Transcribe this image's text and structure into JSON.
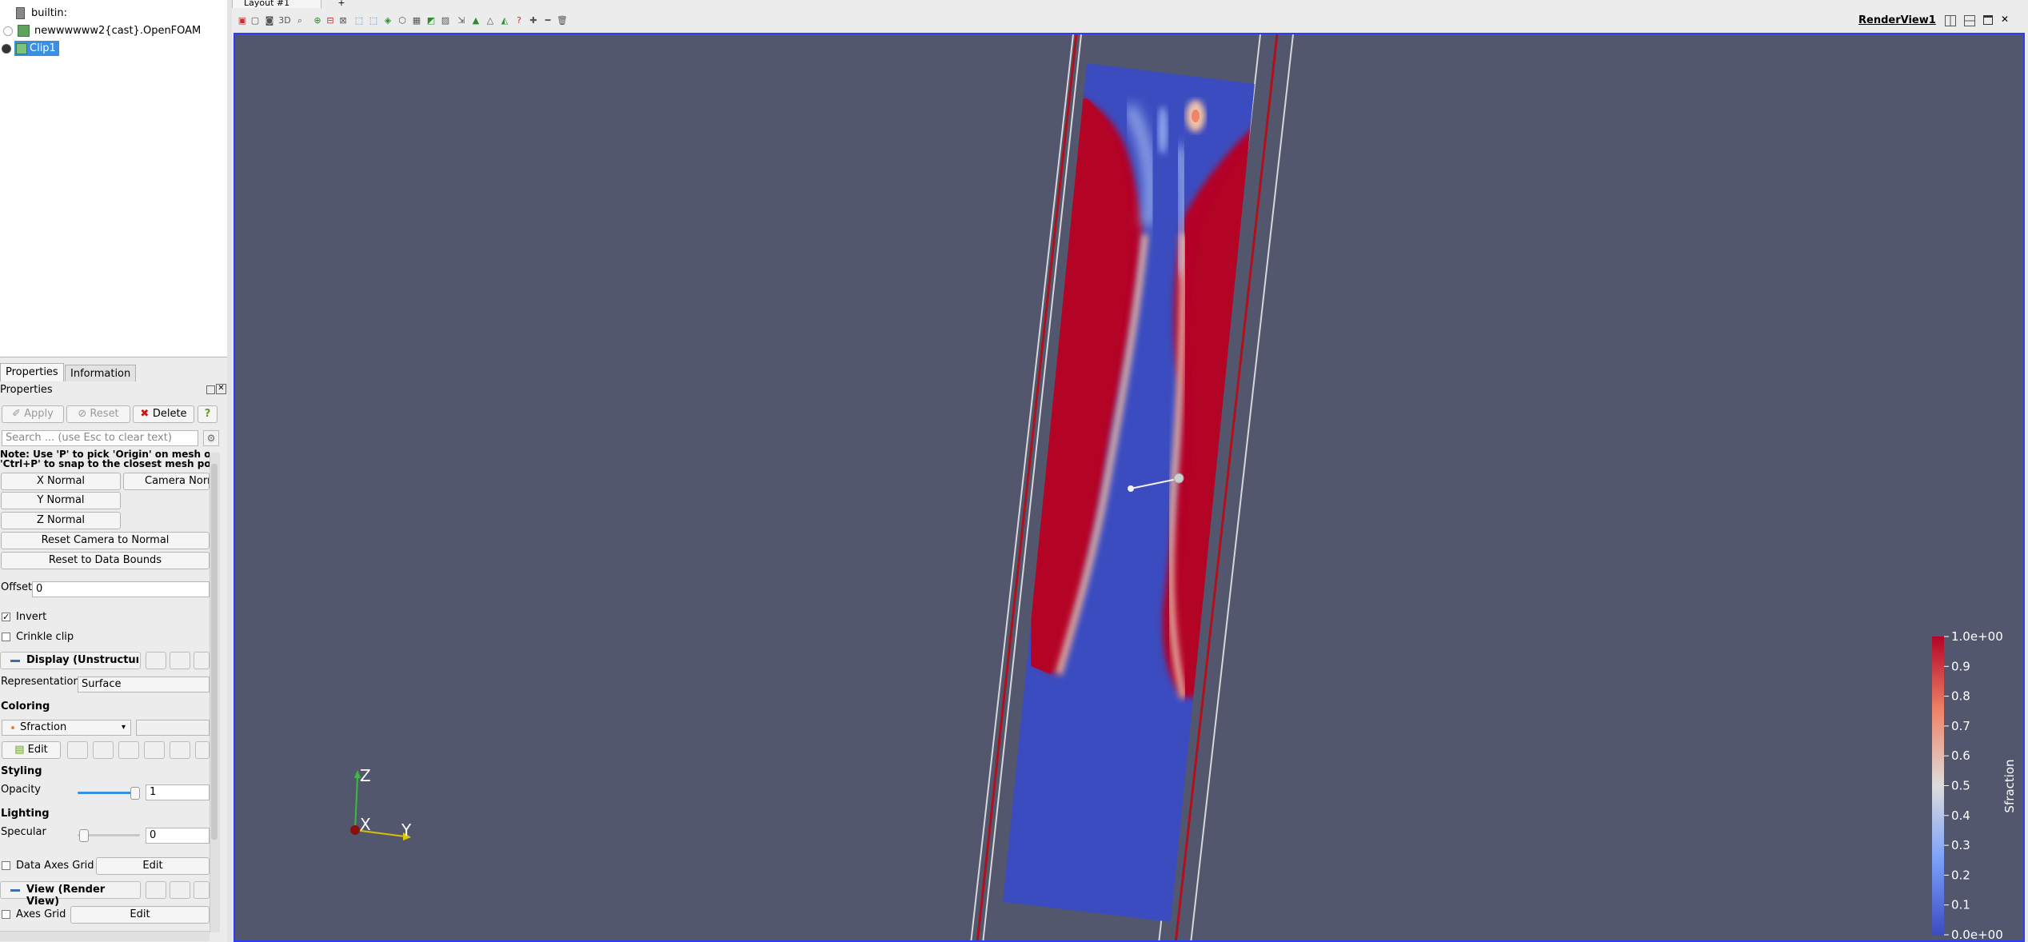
{
  "layout_tab": {
    "label": "Layout #1",
    "add_label": "+"
  },
  "pipeline": {
    "items": [
      {
        "label": "builtin:"
      },
      {
        "label": "newwwwww2{cast}.OpenFOAM"
      },
      {
        "label": "Clip1"
      }
    ]
  },
  "panel_tabs": {
    "properties": "Properties",
    "information": "Information"
  },
  "properties": {
    "header": "Properties",
    "apply_label": "Apply",
    "reset_label": "Reset",
    "delete_label": "Delete",
    "help_label": "?",
    "search_placeholder": "Search ... (use Esc to clear text)",
    "note_line1": "Note: Use 'P' to pick 'Origin' on mesh o",
    "note_line2": "'Ctrl+P' to snap to the closest mesh po",
    "x_normal": "X Normal",
    "camera_normal": "Camera Norm",
    "y_normal": "Y Normal",
    "z_normal": "Z Normal",
    "reset_camera": "Reset Camera to Normal",
    "reset_bounds": "Reset to Data Bounds",
    "offset_label": "Offset",
    "offset_value": "0",
    "invert_label": "Invert",
    "crinkle_label": "Crinkle clip",
    "display_section": "Display (Unstructur",
    "representation_label": "Representation",
    "representation_value": "Surface",
    "coloring_label": "Coloring",
    "coloring_value": "Sfraction",
    "edit_label": "Edit",
    "styling_label": "Styling",
    "opacity_label": "Opacity",
    "opacity_value": "1",
    "lighting_label": "Lighting",
    "specular_label": "Specular",
    "specular_value": "0",
    "data_axes_grid_label": "Data Axes Grid",
    "data_axes_edit": "Edit",
    "view_section": "View (Render View)",
    "axes_grid_label": "Axes Grid",
    "axes_grid_edit": "Edit"
  },
  "toolbar": {
    "mode_3d": "3D",
    "render_view_label": "RenderView1"
  },
  "render": {
    "background": "#52576e",
    "orientation_axes": {
      "z": "Z",
      "x": "X",
      "y": "Y"
    },
    "colorbar": {
      "title": "Sfraction",
      "ticks": [
        "1.0e+00",
        "0.9",
        "0.8",
        "0.7",
        "0.6",
        "0.5",
        "0.4",
        "0.3",
        "0.2",
        "0.1",
        "0.0e+00"
      ],
      "colors": {
        "high": "#b40426",
        "mid": "#dddddd",
        "low": "#3b4cc0"
      }
    }
  }
}
